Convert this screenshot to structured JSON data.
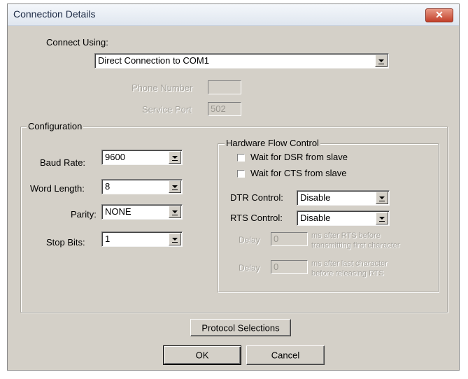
{
  "window": {
    "title": "Connection Details",
    "close_glyph": "✕"
  },
  "connect": {
    "label": "Connect Using:",
    "value": "Direct Connection to COM1",
    "phone_label": "Phone Number",
    "phone_value": "",
    "port_label": "Service Port",
    "port_value": "502"
  },
  "configuration": {
    "legend": "Configuration",
    "baud_label": "Baud Rate:",
    "baud_value": "9600",
    "word_label": "Word Length:",
    "word_value": "8",
    "parity_label": "Parity:",
    "parity_value": "NONE",
    "stop_label": "Stop Bits:",
    "stop_value": "1"
  },
  "hardware": {
    "legend": "Hardware Flow Control",
    "dsr_label": "Wait for DSR from slave",
    "cts_label": "Wait for CTS from slave",
    "dtr_label": "DTR Control:",
    "dtr_value": "Disable",
    "rts_label": "RTS Control:",
    "rts_value": "Disable",
    "delay1_label": "Delay",
    "delay1_value": "0",
    "delay1_desc_1": "ms after RTS before",
    "delay1_desc_2": "transmitting first character",
    "delay2_label": "Delay",
    "delay2_value": "0",
    "delay2_desc_1": "ms after last character",
    "delay2_desc_2": "before releasing RTS"
  },
  "buttons": {
    "protocol": "Protocol Selections",
    "ok": "OK",
    "cancel": "Cancel"
  },
  "colors": {
    "dialog_bg": "#d4d0c8",
    "close_red": "#c2402a"
  }
}
